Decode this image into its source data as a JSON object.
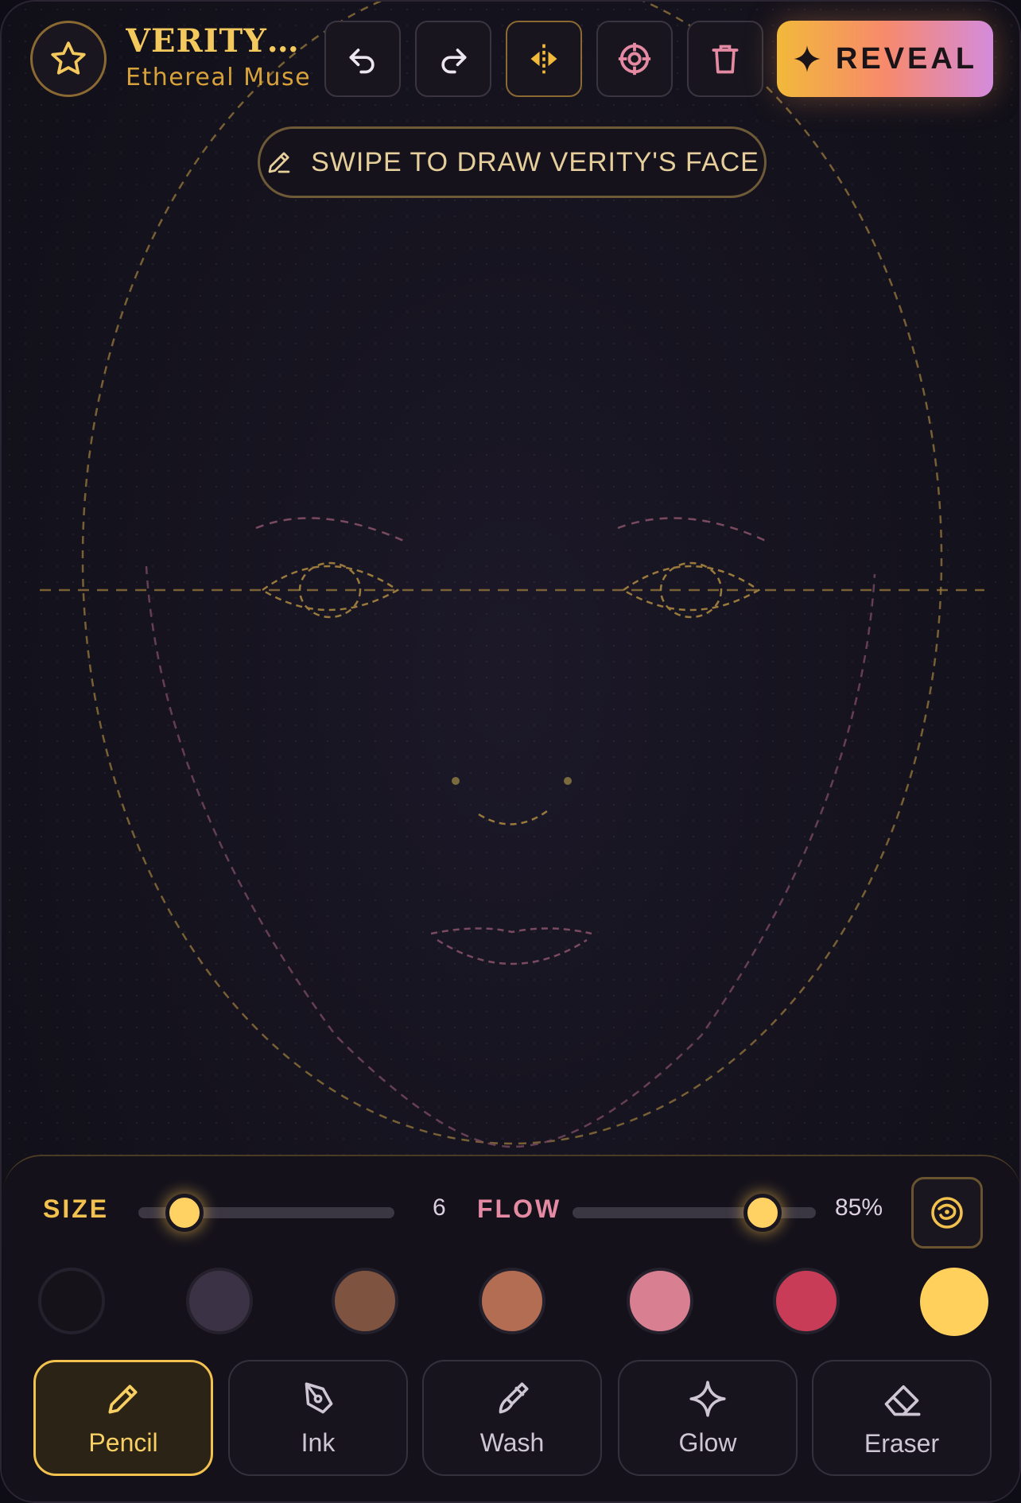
{
  "header": {
    "title": "VERITY A...",
    "subtitle": "Ethereal Muse",
    "reveal_label": "REVEAL",
    "icons": [
      "star-icon",
      "undo-icon",
      "redo-icon",
      "mirror-icon",
      "target-icon",
      "trash-icon",
      "sparkle-icon"
    ]
  },
  "hint": {
    "text": "SWIPE TO DRAW VERITY'S FACE",
    "icon": "pencil-icon"
  },
  "controls": {
    "size": {
      "label": "SIZE",
      "value": "6",
      "level": 0.18
    },
    "flow": {
      "label": "FLOW",
      "value": "85%",
      "level": 0.78
    },
    "reset_icon": "swirl-icon"
  },
  "palette": {
    "colors": [
      "#15121a",
      "#3b3345",
      "#7e5340",
      "#b36d52",
      "#d97f92",
      "#c93c58",
      "#ffd15c"
    ],
    "selected_index": 6
  },
  "brushes": [
    {
      "label": "Pencil",
      "icon": "pencil-icon",
      "active": true
    },
    {
      "label": "Ink",
      "icon": "pen-nib-icon",
      "active": false
    },
    {
      "label": "Wash",
      "icon": "brush-icon",
      "active": false
    },
    {
      "label": "Glow",
      "icon": "sparkle-icon",
      "active": false
    },
    {
      "label": "Eraser",
      "icon": "eraser-icon",
      "active": false
    }
  ],
  "colors": {
    "accent": "#f2c14e",
    "flow_label": "#e58aa3",
    "guide_gold": "#9a7a3c",
    "guide_rose": "#7a4a60"
  }
}
